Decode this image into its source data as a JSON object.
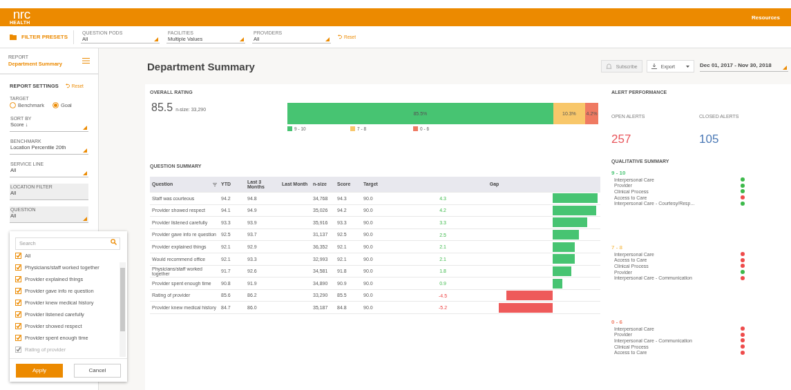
{
  "topbar": {
    "logo": "nrc",
    "logo_sub": "HEALTH",
    "link": "Resources"
  },
  "filterbar": {
    "presets": "FILTER PRESETS",
    "filters": [
      {
        "label": "QUESTION PODS",
        "value": "All"
      },
      {
        "label": "FACILITIES",
        "value": "Multiple Values"
      },
      {
        "label": "PROVIDERS",
        "value": "All"
      }
    ],
    "reset": "Reset"
  },
  "sidebar": {
    "report_label": "REPORT",
    "report_name": "Department Summary",
    "settings_title": "REPORT SETTINGS",
    "reset": "Reset",
    "target": {
      "label": "TARGET",
      "options": [
        {
          "label": "Benchmark",
          "selected": false
        },
        {
          "label": "Goal",
          "selected": true
        }
      ]
    },
    "fields": [
      {
        "label": "SORT BY",
        "value": "Score ↓",
        "kind": "select",
        "active": false
      },
      {
        "label": "BENCHMARK",
        "value": "Location Percentile 20th",
        "kind": "select",
        "active": false
      },
      {
        "label": "SERVICE LINE",
        "value": "All",
        "kind": "select",
        "active": false
      },
      {
        "label": "LOCATION FILTER",
        "value": "All",
        "kind": "static",
        "active": true
      },
      {
        "label": "QUESTION",
        "value": "All",
        "kind": "select",
        "active": true
      }
    ]
  },
  "question_popup": {
    "search_placeholder": "Search",
    "options": [
      {
        "label": "All",
        "checked": true,
        "disabled": false
      },
      {
        "label": "Physicians/staff worked together",
        "checked": true,
        "disabled": false
      },
      {
        "label": "Provider explained things",
        "checked": true,
        "disabled": false
      },
      {
        "label": "Provider gave info re question",
        "checked": true,
        "disabled": false
      },
      {
        "label": "Provider knew medical history",
        "checked": true,
        "disabled": false
      },
      {
        "label": "Provider listened carefully",
        "checked": true,
        "disabled": false
      },
      {
        "label": "Provider showed respect",
        "checked": true,
        "disabled": false
      },
      {
        "label": "Provider spent enough time",
        "checked": true,
        "disabled": false
      },
      {
        "label": "Rating of provider",
        "checked": true,
        "disabled": true
      }
    ],
    "apply": "Apply",
    "cancel": "Cancel"
  },
  "page": {
    "title": "Department Summary",
    "subscribe": {
      "label": "Subscribe",
      "disabled": true
    },
    "export": "Export",
    "date_range": "Dec 01, 2017 - Nov 30, 2018"
  },
  "overall": {
    "title": "OVERALL RATING",
    "score": "85.5",
    "nsize": "n-size: 33,290",
    "segments": [
      {
        "label": "85.5%",
        "color": "#47c472"
      },
      {
        "label": "10.3%",
        "color": "#f8c76a"
      },
      {
        "label": "4.2%",
        "color": "#ef7a62"
      }
    ],
    "legend": [
      {
        "label": "9 - 10",
        "color": "#47c472"
      },
      {
        "label": "7 - 8",
        "color": "#f8c76a"
      },
      {
        "label": "0 - 6",
        "color": "#ef7a62"
      }
    ]
  },
  "question_summary": {
    "title": "QUESTION SUMMARY",
    "columns": [
      "Question",
      "YTD",
      "Last 3 Months",
      "Last Month",
      "n-size",
      "Score",
      "Target",
      "Gap"
    ],
    "rows": [
      {
        "question": "Staff was courteous",
        "ytd": "94.2",
        "last3": "94.8",
        "nsize": "34,768",
        "score": "94.3",
        "target": "90.0",
        "gap": "4.3"
      },
      {
        "question": "Provider showed respect",
        "ytd": "94.1",
        "last3": "94.9",
        "nsize": "35,026",
        "score": "94.2",
        "target": "90.0",
        "gap": "4.2"
      },
      {
        "question": "Provider listened carefully",
        "ytd": "93.3",
        "last3": "93.9",
        "nsize": "35,916",
        "score": "93.3",
        "target": "90.0",
        "gap": "3.3"
      },
      {
        "question": "Provider gave info re question",
        "ytd": "92.5",
        "last3": "93.7",
        "nsize": "31,137",
        "score": "92.5",
        "target": "90.0",
        "gap": "2.5"
      },
      {
        "question": "Provider explained things",
        "ytd": "92.1",
        "last3": "92.9",
        "nsize": "36,352",
        "score": "92.1",
        "target": "90.0",
        "gap": "2.1"
      },
      {
        "question": "Would recommend office",
        "ytd": "92.1",
        "last3": "93.3",
        "nsize": "32,993",
        "score": "92.1",
        "target": "90.0",
        "gap": "2.1"
      },
      {
        "question": "Physicians/staff worked together",
        "ytd": "91.7",
        "last3": "92.6",
        "nsize": "34,581",
        "score": "91.8",
        "target": "90.0",
        "gap": "1.8"
      },
      {
        "question": "Provider spent enough time",
        "ytd": "90.8",
        "last3": "91.9",
        "nsize": "34,890",
        "score": "90.9",
        "target": "90.0",
        "gap": "0.9"
      },
      {
        "question": "Rating of provider",
        "ytd": "85.6",
        "last3": "86.2",
        "nsize": "33,290",
        "score": "85.5",
        "target": "90.0",
        "gap": "-4.5"
      },
      {
        "question": "Provider knew medical history",
        "ytd": "84.7",
        "last3": "86.0",
        "nsize": "35,187",
        "score": "84.8",
        "target": "90.0",
        "gap": "-5.2"
      }
    ]
  },
  "alerts": {
    "title": "ALERT PERFORMANCE",
    "open_label": "OPEN ALERTS",
    "open_value": "257",
    "closed_label": "CLOSED ALERTS",
    "closed_value": "105"
  },
  "qualitative": {
    "title": "QUALITATIVE SUMMARY",
    "groups": [
      {
        "label": "9 - 10",
        "color": "#47c472",
        "items": [
          {
            "label": "Interpersonal Care",
            "color": "#3cb94a"
          },
          {
            "label": "Provider",
            "color": "#3cb94a"
          },
          {
            "label": "Clinical Process",
            "color": "#3cb94a"
          },
          {
            "label": "Access to Care",
            "color": "#ee4b4b"
          },
          {
            "label": "Interpersonal Care - Courtesy/Resp...",
            "color": "#3cb94a"
          }
        ]
      },
      {
        "label": "7 - 8",
        "color": "#f8c76a",
        "items": [
          {
            "label": "Interpersonal Care",
            "color": "#ee4b4b"
          },
          {
            "label": "Access to Care",
            "color": "#ee4b4b"
          },
          {
            "label": "Clinical Process",
            "color": "#ee4b4b"
          },
          {
            "label": "Provider",
            "color": "#3cb94a"
          },
          {
            "label": "Interpersonal Care - Communication",
            "color": "#ee4b4b"
          }
        ]
      },
      {
        "label": "0 - 6",
        "color": "#ef7a62",
        "items": [
          {
            "label": "Interpersonal Care",
            "color": "#ee4b4b"
          },
          {
            "label": "Provider",
            "color": "#ee4b4b"
          },
          {
            "label": "Interpersonal Care - Communication",
            "color": "#ee4b4b"
          },
          {
            "label": "Clinical Process",
            "color": "#ee4b4b"
          },
          {
            "label": "Access to Care",
            "color": "#ee4b4b"
          }
        ]
      }
    ]
  }
}
